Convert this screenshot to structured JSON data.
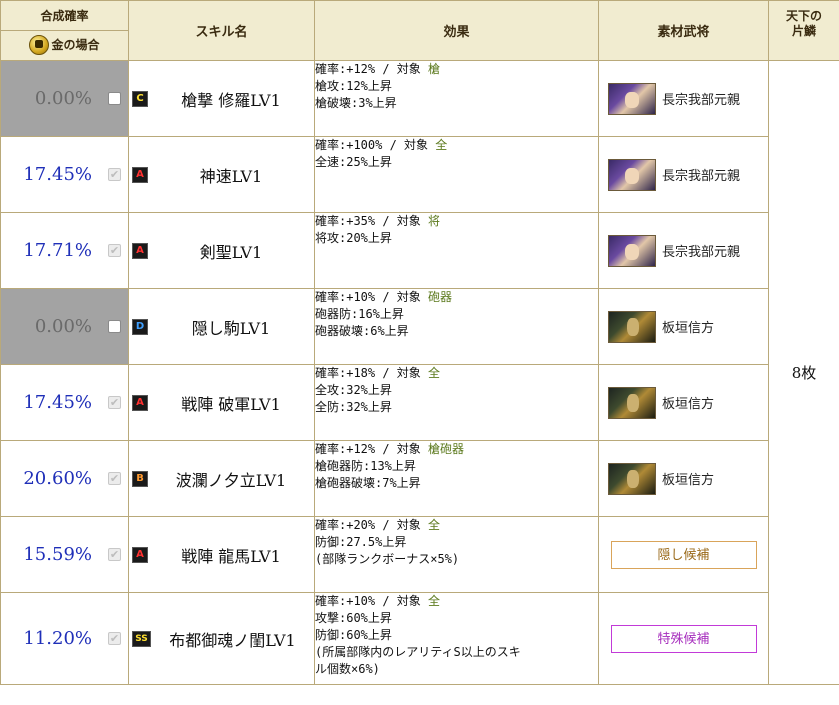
{
  "header": {
    "rate_title": "合成確率",
    "gold_label": "金の場合",
    "skill_col": "スキル名",
    "effect_col": "効果",
    "material_col": "素材武将",
    "tenka_col": "天下の\n片鱗"
  },
  "rows": [
    {
      "rate": "0.00%",
      "checked": false,
      "rank": "C",
      "skill": "槍撃 修羅LV1",
      "effect": {
        "prefix": "確率:+12% / 対象 ",
        "target": "槍",
        "lines": [
          "槍攻:12%上昇",
          "槍破壊:3%上昇"
        ]
      },
      "material": {
        "type": "general",
        "name": "長宗我部元親",
        "portrait": "chosokabe"
      }
    },
    {
      "rate": "17.45%",
      "checked": true,
      "rank": "A",
      "skill": "神速LV1",
      "effect": {
        "prefix": "確率:+100% / 対象 ",
        "target": "全",
        "lines": [
          "全速:25%上昇"
        ]
      },
      "material": {
        "type": "general",
        "name": "長宗我部元親",
        "portrait": "chosokabe"
      }
    },
    {
      "rate": "17.71%",
      "checked": true,
      "rank": "A",
      "skill": "剣聖LV1",
      "effect": {
        "prefix": "確率:+35% / 対象 ",
        "target": "将",
        "lines": [
          "将攻:20%上昇"
        ]
      },
      "material": {
        "type": "general",
        "name": "長宗我部元親",
        "portrait": "chosokabe"
      }
    },
    {
      "rate": "0.00%",
      "checked": false,
      "rank": "D",
      "skill": "隠し駒LV1",
      "effect": {
        "prefix": "確率:+10% / 対象 ",
        "target": "砲器",
        "lines": [
          "砲器防:16%上昇",
          "砲器破壊:6%上昇"
        ]
      },
      "material": {
        "type": "general",
        "name": "板垣信方",
        "portrait": "itagaki"
      }
    },
    {
      "rate": "17.45%",
      "checked": true,
      "rank": "A",
      "skill": "戦陣 破軍LV1",
      "effect": {
        "prefix": "確率:+18% / 対象 ",
        "target": "全",
        "lines": [
          "全攻:32%上昇",
          "全防:32%上昇"
        ]
      },
      "material": {
        "type": "general",
        "name": "板垣信方",
        "portrait": "itagaki"
      }
    },
    {
      "rate": "20.60%",
      "checked": true,
      "rank": "B",
      "skill": "波瀾ノ夕立LV1",
      "effect": {
        "prefix": "確率:+12% / 対象 ",
        "target": "槍砲器",
        "lines": [
          "槍砲器防:13%上昇",
          "槍砲器破壊:7%上昇"
        ]
      },
      "material": {
        "type": "general",
        "name": "板垣信方",
        "portrait": "itagaki"
      }
    },
    {
      "rate": "15.59%",
      "checked": true,
      "rank": "A",
      "skill": "戦陣 龍馬LV1",
      "effect": {
        "prefix": "確率:+20% / 対象 ",
        "target": "全",
        "lines": [
          "防御:27.5%上昇",
          "(部隊ランクボーナス×5%)"
        ]
      },
      "material": {
        "type": "button",
        "label": "隠し候補",
        "style": "hidden"
      }
    },
    {
      "rate": "11.20%",
      "checked": true,
      "rank": "SS",
      "skill": "布都御魂ノ閨LV1",
      "effect": {
        "prefix": "確率:+10% / 対象 ",
        "target": "全",
        "lines": [
          "攻撃:60%上昇",
          "防御:60%上昇",
          "(所属部隊内のレアリティS以上のスキ",
          "ル個数×6%)"
        ]
      },
      "material": {
        "type": "button",
        "label": "特殊候補",
        "style": "special"
      }
    }
  ],
  "tenka_value": "8枚",
  "colors": {
    "rate_blue": "#1f2fb8",
    "header_bg": "#f1ecd0",
    "disabled_bg": "#a3a3a3",
    "target_green": "#5c7a1e"
  }
}
